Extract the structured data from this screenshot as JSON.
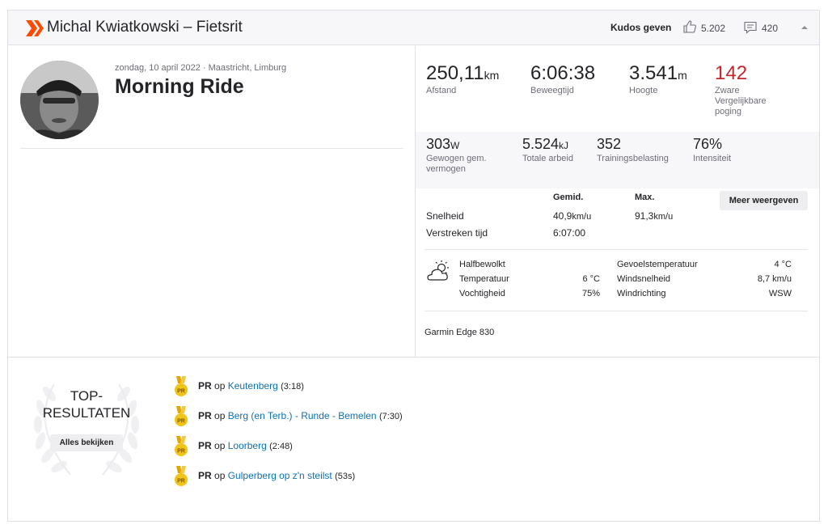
{
  "header": {
    "title": "Michal Kwiatkowski – Fietsrit",
    "kudos_label": "Kudos geven",
    "kudos_count": "5.202",
    "comment_count": "420"
  },
  "athlete": {
    "date_location": "zondag, 10 april 2022 · Maastricht, Limburg",
    "activity_title": "Morning Ride"
  },
  "primary_stats": [
    {
      "value": "250,11",
      "unit": "km",
      "label": "Afstand"
    },
    {
      "value": "6:06:38",
      "unit": "",
      "label": "Beweegtijd"
    },
    {
      "value": "3.541",
      "unit": "m",
      "label": "Hoogte"
    },
    {
      "value": "142",
      "unit": "",
      "label_line1": "Zware",
      "label_line2": "Vergelijkbare",
      "label_line3": "poging"
    }
  ],
  "secondary_stats": [
    {
      "value": "303",
      "unit": "W",
      "label_line1": "Gewogen gem.",
      "label_line2": "vermogen"
    },
    {
      "value": "5.524",
      "unit": "kJ",
      "label": "Totale arbeid"
    },
    {
      "value": "352",
      "unit": "",
      "label": "Trainingsbelasting"
    },
    {
      "value": "76%",
      "unit": "",
      "label": "Intensiteit"
    }
  ],
  "details": {
    "col_avg": "Gemid.",
    "col_max": "Max.",
    "more_button": "Meer weergeven",
    "speed_label": "Snelheid",
    "speed_avg": "40,9",
    "speed_avg_unit": "km/u",
    "speed_max": "91,3",
    "speed_max_unit": "km/u",
    "elapsed_label": "Verstreken tijd",
    "elapsed_value": "6:07:00"
  },
  "weather": {
    "condition": "Halfbewolkt",
    "temp_label": "Temperatuur",
    "temp_value": "6 °C",
    "humidity_label": "Vochtigheid",
    "humidity_value": "75%",
    "feels_label": "Gevoelstemperatuur",
    "feels_value": "4 °C",
    "wind_speed_label": "Windsnelheid",
    "wind_speed_value": "8,7 km/u",
    "wind_dir_label": "Windrichting",
    "wind_dir_value": "WSW"
  },
  "device": "Garmin Edge 830",
  "top_results": {
    "title_line1": "TOP-",
    "title_line2": "RESULTATEN",
    "view_all": "Alles bekijken",
    "pr_label": "PR",
    "op_word": "op",
    "items": [
      {
        "segment": "Keutenberg",
        "time": "(3:18)"
      },
      {
        "segment": "Berg (en Terb.) - Runde - Bemelen",
        "time": "(7:30)"
      },
      {
        "segment": "Loorberg",
        "time": "(2:48)"
      },
      {
        "segment": "Gulperberg op z'n steilst",
        "time": "(53s)"
      }
    ]
  },
  "colors": {
    "brand": "#fc5200",
    "link": "#0e71b8",
    "highlight_red": "#c0282e",
    "medal": "#f0c419"
  }
}
